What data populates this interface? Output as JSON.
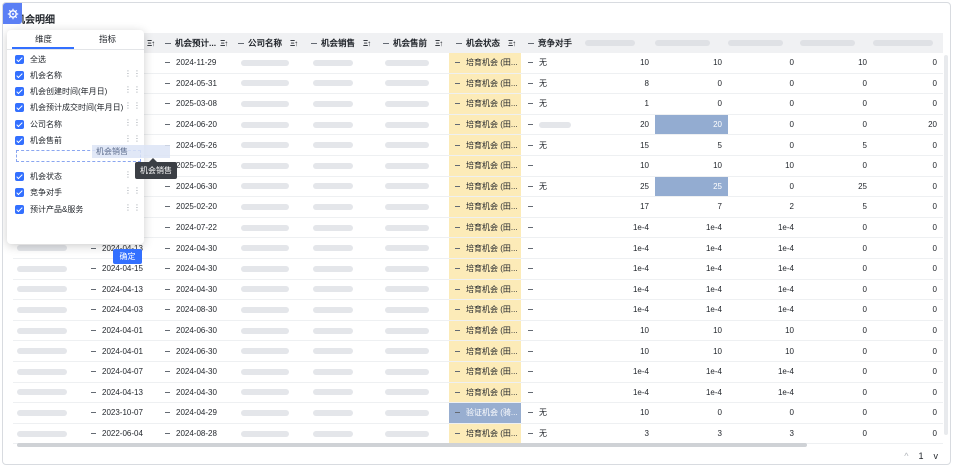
{
  "title": "机会明细",
  "popup": {
    "tabs": [
      "维度",
      "指标"
    ],
    "options": [
      {
        "label": "全选"
      },
      {
        "label": "机会名称"
      },
      {
        "label": "机会创建时间(年月日)"
      },
      {
        "label": "机会预计成交时间(年月日)"
      },
      {
        "label": "公司名称"
      },
      {
        "label": "机会售前"
      },
      {
        "label": "机会状态"
      },
      {
        "label": "竞争对手"
      },
      {
        "label": "预计产品&服务"
      }
    ],
    "dragging_label": "机会销售",
    "tooltip": "机会销售",
    "confirm_label": "确定"
  },
  "columns": {
    "expected": "机会预计...",
    "company": "公司名称",
    "sales": "机会销售",
    "presales": "机会售前",
    "status": "机会状态",
    "competitor": "竞争对手"
  },
  "rows": [
    {
      "created": "",
      "expected": "2024-11-29",
      "status": "培育机会 (田...",
      "competitor": "无",
      "n": [
        "10",
        "10",
        "0",
        "10",
        "0"
      ]
    },
    {
      "created": "",
      "expected": "2024-05-31",
      "status": "培育机会 (田...",
      "competitor": "无",
      "n": [
        "8",
        "0",
        "0",
        "0",
        "0"
      ]
    },
    {
      "created": "",
      "expected": "2025-03-08",
      "status": "培育机会 (田...",
      "competitor": "无",
      "n": [
        "1",
        "0",
        "0",
        "0",
        "0"
      ]
    },
    {
      "created": "",
      "expected": "2024-06-20",
      "status": "培育机会 (田...",
      "competitor": "",
      "n": [
        "20",
        "20",
        "0",
        "0",
        "20"
      ]
    },
    {
      "created": "",
      "expected": "2024-05-26",
      "status": "培育机会 (田...",
      "competitor": "无",
      "n": [
        "15",
        "5",
        "0",
        "5",
        "0"
      ]
    },
    {
      "created": "",
      "expected": "2025-02-25",
      "status": "培育机会 (田...",
      "competitor": "",
      "n": [
        "10",
        "10",
        "10",
        "0",
        "0"
      ]
    },
    {
      "created": "",
      "expected": "2024-06-30",
      "status": "培育机会 (田...",
      "competitor": "无",
      "n": [
        "25",
        "25",
        "0",
        "25",
        "0"
      ]
    },
    {
      "created": "",
      "expected": "2025-02-20",
      "status": "培育机会 (田...",
      "competitor": "",
      "n": [
        "17",
        "7",
        "2",
        "5",
        "0"
      ]
    },
    {
      "created": "",
      "expected": "2024-07-22",
      "status": "培育机会 (田...",
      "competitor": "",
      "n": [
        "1e-4",
        "1e-4",
        "1e-4",
        "0",
        "0"
      ]
    },
    {
      "created": "2024-04-13",
      "expected": "2024-04-30",
      "status": "培育机会 (田...",
      "competitor": "",
      "n": [
        "1e-4",
        "1e-4",
        "1e-4",
        "0",
        "0"
      ]
    },
    {
      "created": "2024-04-15",
      "expected": "2024-04-30",
      "status": "培育机会 (田...",
      "competitor": "",
      "n": [
        "1e-4",
        "1e-4",
        "1e-4",
        "0",
        "0"
      ]
    },
    {
      "created": "2024-04-13",
      "expected": "2024-04-30",
      "status": "培育机会 (田...",
      "competitor": "",
      "n": [
        "1e-4",
        "1e-4",
        "1e-4",
        "0",
        "0"
      ]
    },
    {
      "created": "2024-04-03",
      "expected": "2024-08-30",
      "status": "培育机会 (田...",
      "competitor": "",
      "n": [
        "1e-4",
        "1e-4",
        "1e-4",
        "0",
        "0"
      ]
    },
    {
      "created": "2024-04-01",
      "expected": "2024-06-30",
      "status": "培育机会 (田...",
      "competitor": "",
      "n": [
        "10",
        "10",
        "10",
        "0",
        "0"
      ]
    },
    {
      "created": "2024-04-01",
      "expected": "2024-06-30",
      "status": "培育机会 (田...",
      "competitor": "",
      "n": [
        "10",
        "10",
        "10",
        "0",
        "0"
      ]
    },
    {
      "created": "2024-04-07",
      "expected": "2024-04-30",
      "status": "培育机会 (田...",
      "competitor": "",
      "n": [
        "1e-4",
        "1e-4",
        "1e-4",
        "0",
        "0"
      ]
    },
    {
      "created": "2024-04-13",
      "expected": "2024-04-30",
      "status": "培育机会 (田...",
      "competitor": "",
      "n": [
        "1e-4",
        "1e-4",
        "1e-4",
        "0",
        "0"
      ]
    },
    {
      "created": "2023-10-07",
      "expected": "2024-04-29",
      "status": "验证机会 (骑...",
      "competitor": "无",
      "n": [
        "10",
        "0",
        "0",
        "0",
        "0"
      ]
    },
    {
      "created": "2022-06-04",
      "expected": "2024-08-28",
      "status": "培育机会 (田...",
      "competitor": "无",
      "n": [
        "3",
        "3",
        "3",
        "0",
        "0"
      ]
    }
  ],
  "pager": {
    "up": "^",
    "page": "1",
    "down": "v"
  },
  "colors": {
    "accent": "#3370ff",
    "status_bg": "#fcebb8",
    "highlight": "#93acd1"
  }
}
